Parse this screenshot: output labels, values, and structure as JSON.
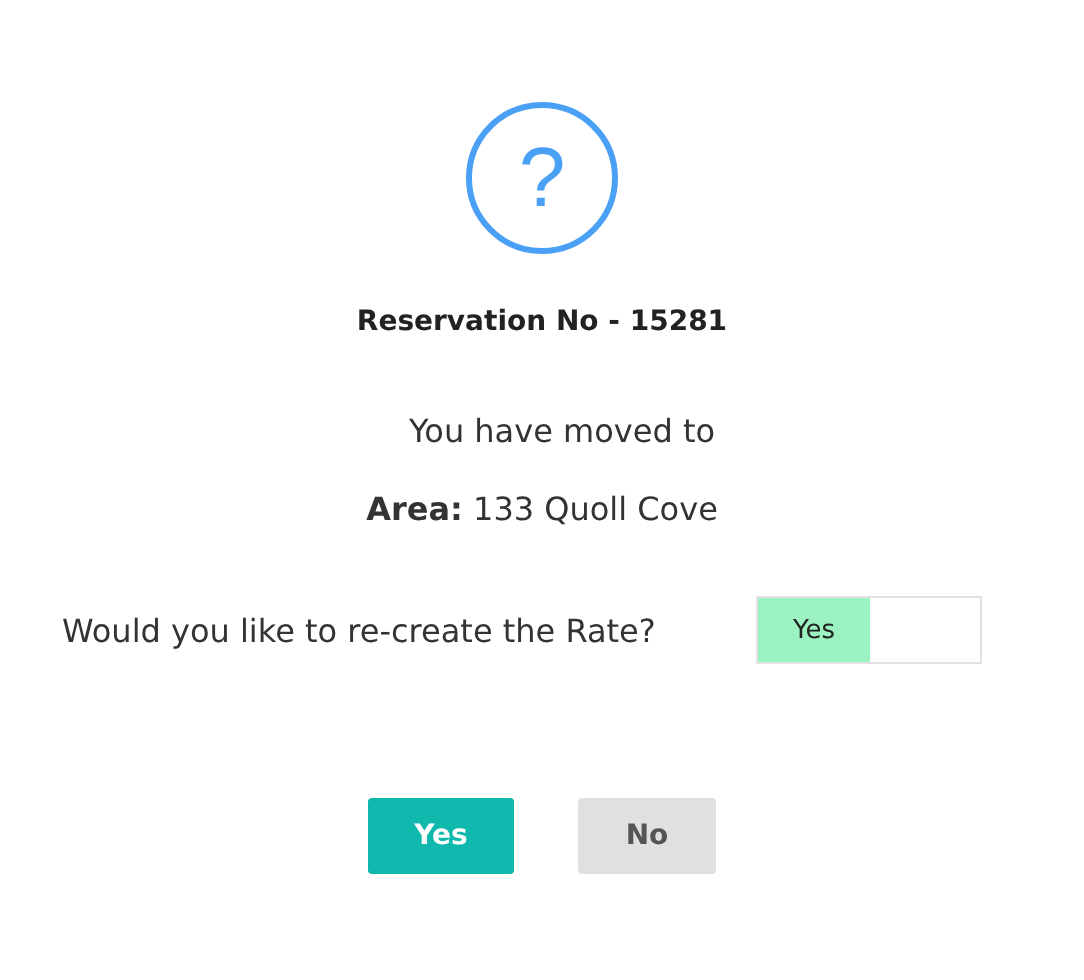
{
  "icon": {
    "glyph": "?"
  },
  "title": "Reservation No - 15281",
  "message": "You have moved to",
  "area": "**Area:** 133 Quoll Cove",
  "question": {
    "label": "Would you like to re-create the Rate?",
    "toggle": {
      "label": "Yes",
      "on": true
    }
  },
  "buttons": [
    {
      "label": "Yes",
      "kind": "primary"
    },
    {
      "label": "No",
      "kind": "secondary"
    }
  ]
}
